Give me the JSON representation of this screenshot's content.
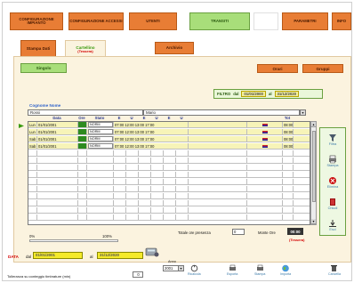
{
  "nav": [
    {
      "label": "CONFIGURAZIONE IMPIANTO"
    },
    {
      "label": "CONFIGURAZIONE ACCESSI"
    },
    {
      "label": "UTENTI"
    },
    {
      "label": "TRANSITI"
    },
    {
      "label": ""
    },
    {
      "label": "PARAMETRI"
    },
    {
      "label": "INFO"
    }
  ],
  "subtabs": [
    {
      "label": "Stampa Dati"
    },
    {
      "label": "Cartellino",
      "sub": "(Tessera)"
    },
    {
      "label": "Archivio"
    }
  ],
  "view_tabs": {
    "left": "Singolo",
    "right1": "Orari",
    "right2": "Gruppi"
  },
  "filter": {
    "label": "FILTRO",
    "from_prefix": "dal",
    "from": "01/01/2000",
    "to_prefix": "al",
    "to": "31/12/2020"
  },
  "employee": {
    "label": "Cognome Nome",
    "value": "Rossi",
    "value2": "Mario"
  },
  "columns": [
    "",
    "Data",
    "Ore",
    "Stato",
    "E",
    "U",
    "E",
    "U",
    "E",
    "U",
    "",
    "",
    "Tot"
  ],
  "rows": [
    {
      "day": "Lun",
      "date": "01/01/2001",
      "state": "NORM",
      "times": "07:00 12:00 13:00 17:00",
      "tot": "08:00"
    },
    {
      "day": "Lun",
      "date": "01/01/2001",
      "state": "NORM",
      "times": "07:00 12:00 13:00 17:00",
      "tot": "08:00"
    },
    {
      "day": "Sab",
      "date": "01/01/2001",
      "state": "NORM",
      "times": "07:00 12:00 13:00 17:00",
      "tot": "08:00"
    },
    {
      "day": "Sab",
      "date": "01/01/2001",
      "state": "NORM",
      "times": "07:00 12:00 13:00 17:00",
      "tot": "08:00"
    }
  ],
  "side_tools": [
    {
      "label": "Filtra",
      "icon": "filter-icon"
    },
    {
      "label": "Stampa",
      "icon": "print-icon"
    },
    {
      "label": "Elimina",
      "icon": "delete-icon"
    },
    {
      "label": "Chiudi",
      "icon": "exit-icon"
    },
    {
      "label": "Esci",
      "icon": "close-icon"
    }
  ],
  "progress": {
    "left": "0%",
    "right": "100%",
    "value": 0
  },
  "totals": {
    "label": "Totale ore presenza",
    "value": "0",
    "label2": "Monte Ore",
    "value2": "00:00",
    "sub": "(Tessera)"
  },
  "footer": {
    "data_label": "DATA",
    "from_prefix": "dal",
    "from": "01/01/2001",
    "to_prefix": "al",
    "to": "31/12/2020",
    "note": "Tolleranza su conteggio timbrature (min)",
    "note_value": "0",
    "anno_label": "Anno",
    "anno_value": "2001",
    "tools": [
      "Ricalcola",
      "Esporta",
      "Stampa",
      "Importa",
      "Cancella"
    ]
  },
  "colors": {
    "orange": "#e87d35",
    "green": "#a8de7a",
    "panel": "#fbf3df"
  }
}
